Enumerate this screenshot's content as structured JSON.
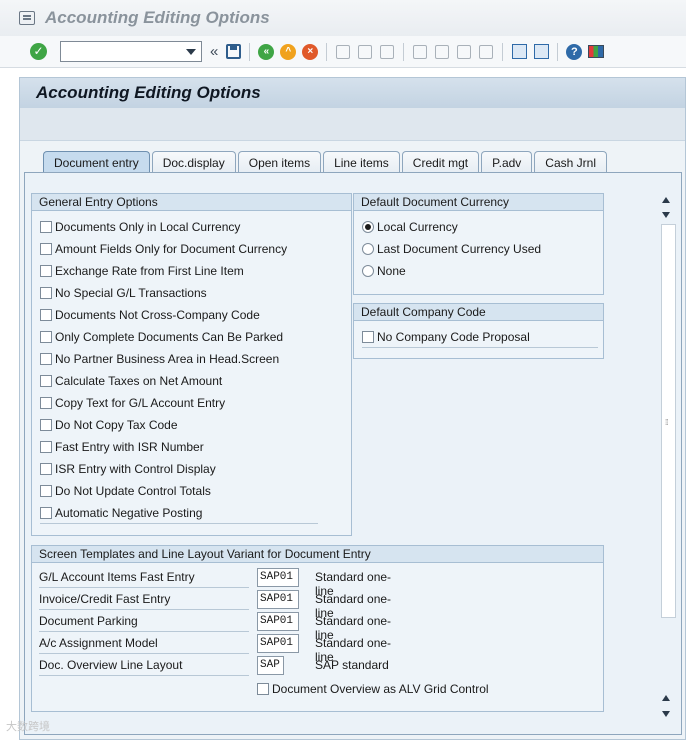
{
  "window": {
    "title": "Accounting Editing Options"
  },
  "toolbar": {
    "command_value": "",
    "chevron": "«"
  },
  "screen": {
    "title": "Accounting Editing Options"
  },
  "tabs": [
    {
      "label": "Document entry",
      "active": true
    },
    {
      "label": "Doc.display"
    },
    {
      "label": "Open items"
    },
    {
      "label": "Line items"
    },
    {
      "label": "Credit mgt"
    },
    {
      "label": "P.adv"
    },
    {
      "label": "Cash Jrnl"
    }
  ],
  "general_entry": {
    "title": "General Entry Options",
    "options": [
      "Documents Only in Local Currency",
      "Amount Fields Only for Document Currency",
      "Exchange Rate from First Line Item",
      "No Special G/L Transactions",
      "Documents Not Cross-Company Code",
      "Only Complete Documents Can Be Parked",
      "No Partner Business Area in Head.Screen",
      "Calculate Taxes on Net Amount",
      "Copy Text for G/L Account Entry",
      "Do Not Copy Tax Code",
      "Fast Entry with ISR Number",
      "ISR Entry with Control Display",
      "Do Not Update Control Totals",
      "Automatic Negative Posting"
    ]
  },
  "default_currency": {
    "title": "Default Document Currency",
    "options": [
      "Local Currency",
      "Last Document Currency Used",
      "None"
    ],
    "selected": "Local Currency"
  },
  "default_company": {
    "title": "Default Company Code",
    "option": "No Company Code Proposal"
  },
  "templates": {
    "title": "Screen Templates and Line Layout Variant for Document Entry",
    "rows": [
      {
        "label": "G/L Account Items Fast Entry",
        "value": "SAP01",
        "desc": "Standard one-line"
      },
      {
        "label": "Invoice/Credit Fast Entry",
        "value": "SAP01",
        "desc": "Standard one-line"
      },
      {
        "label": "Document Parking",
        "value": "SAP01",
        "desc": "Standard one-line"
      },
      {
        "label": "A/c Assignment Model",
        "value": "SAP01",
        "desc": "Standard one-line"
      },
      {
        "label": "Doc. Overview Line Layout",
        "value": "SAP",
        "desc": "SAP standard"
      }
    ],
    "alv_option": "Document Overview as ALV Grid Control"
  },
  "watermark": "大数跨境"
}
